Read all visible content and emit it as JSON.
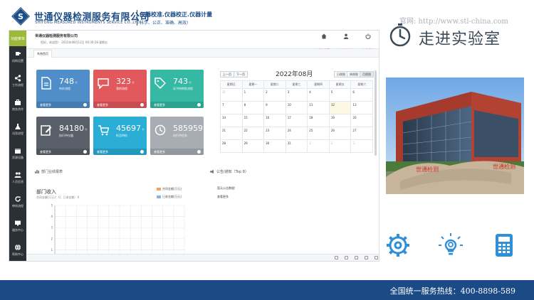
{
  "banner": {
    "company_cn": "世通仪器检测服务有限公司",
    "company_en": "SHITONG MEASURED INSTRUMENTS SERVICE CO.,LTD.",
    "tagline1": "仪器校准.仪器校正.仪器计量",
    "tagline2": "科学、公正、准确、高效!",
    "site_url": "官网: http://www.stl-china.com",
    "lab_title": "走进实验室"
  },
  "app": {
    "sidebar_badge": "功能菜单",
    "sidebar_items": [
      {
        "label": "机构设置",
        "icon": "cup-icon"
      },
      {
        "label": "工作流程",
        "icon": "share-icon"
      },
      {
        "label": "商务合作",
        "icon": "briefcase-icon"
      },
      {
        "label": "试验进程",
        "icon": "flask-icon"
      },
      {
        "label": "资源设备",
        "icon": "calendar-icon"
      },
      {
        "label": "人员信息",
        "icon": "users-icon"
      },
      {
        "label": "审核流程",
        "icon": "refresh-icon"
      },
      {
        "label": "服务中心",
        "icon": "monitor-icon"
      },
      {
        "label": "帮助中心",
        "icon": "globe-icon"
      }
    ],
    "company_name": "世通仪器检测服务有限公司",
    "welcome": "您好，欢迎您！ 2022年08月12日 00:30:28 星期五",
    "header_buttons": [
      {
        "label": "系统首页",
        "icon": "home-icon"
      },
      {
        "label": "个人中心",
        "icon": "user-icon"
      },
      {
        "label": "安全退出",
        "icon": "power-icon"
      }
    ],
    "tab": "系统首页",
    "tiles": [
      {
        "value": "748",
        "unit": "个",
        "label": "待办流程",
        "foot": "查看更多",
        "color": "#4f8ec9",
        "icon": "document-icon"
      },
      {
        "value": "323",
        "unit": "个",
        "label": "我的流程",
        "foot": "查看更多",
        "color": "#e2595d",
        "icon": "chat-icon"
      },
      {
        "value": "743",
        "unit": "个",
        "label": "证书待审批流程",
        "foot": "查看更多",
        "color": "#35b9a5",
        "icon": "tag-icon"
      },
      {
        "value": "84180",
        "unit": "个",
        "label": "执行中仪器",
        "foot": "查看更多",
        "color": "#5a6069",
        "icon": "edit-icon"
      },
      {
        "value": "45697",
        "unit": "个",
        "label": "样品待检",
        "foot": "查看更多",
        "color": "#2aaed6",
        "icon": "cart-icon"
      },
      {
        "value": "585959",
        "unit": "个",
        "label": "执行中任务",
        "foot": "查看更多",
        "color": "#a8adb4",
        "icon": "clock-icon"
      }
    ],
    "calendar": {
      "prev": "上一页",
      "next": "下一页",
      "title": "2022年08月",
      "views": [
        "日视图",
        "周视图",
        "月视图"
      ],
      "weekdays": [
        "星期日",
        "星期一",
        "星期二",
        "星期三",
        "星期四",
        "星期五",
        "星期六"
      ],
      "rows": [
        [
          "31",
          "1",
          "2",
          "3",
          "4",
          "5",
          "6"
        ],
        [
          "7",
          "8",
          "9",
          "10",
          "11",
          "12",
          "13"
        ],
        [
          "14",
          "15",
          "16",
          "17",
          "18",
          "19",
          "20"
        ],
        [
          "21",
          "22",
          "23",
          "24",
          "25",
          "26",
          "27"
        ],
        [
          "28",
          "29",
          "30",
          "31",
          "1",
          "2",
          "3"
        ]
      ],
      "today": "12"
    },
    "dept_panel_title": "部门业绩报表",
    "notice_panel_title": "公告/通知（Top 8）",
    "chart_title": "部门收入",
    "chart_subtitle": "合同金额(万元)：0，已收金额：0",
    "legend": [
      {
        "label": "合同金额(万元)",
        "color": "#f0a35a"
      },
      {
        "label": "已收金额(万元)",
        "color": "#7fb7e8"
      }
    ],
    "notices": [
      "暂无公告数据!",
      "查看更多"
    ]
  },
  "chart_data": {
    "type": "bar",
    "title": "部门收入",
    "categories": [],
    "series": [
      {
        "name": "合同金额(万元)",
        "values": []
      },
      {
        "name": "已收金额(万元)",
        "values": []
      }
    ],
    "ylim": [
      0,
      5
    ],
    "yticks": [
      "5",
      "4",
      "3",
      "2",
      "1"
    ],
    "grid": true
  },
  "hotline": "全国统一服务热线：400-8898-589"
}
